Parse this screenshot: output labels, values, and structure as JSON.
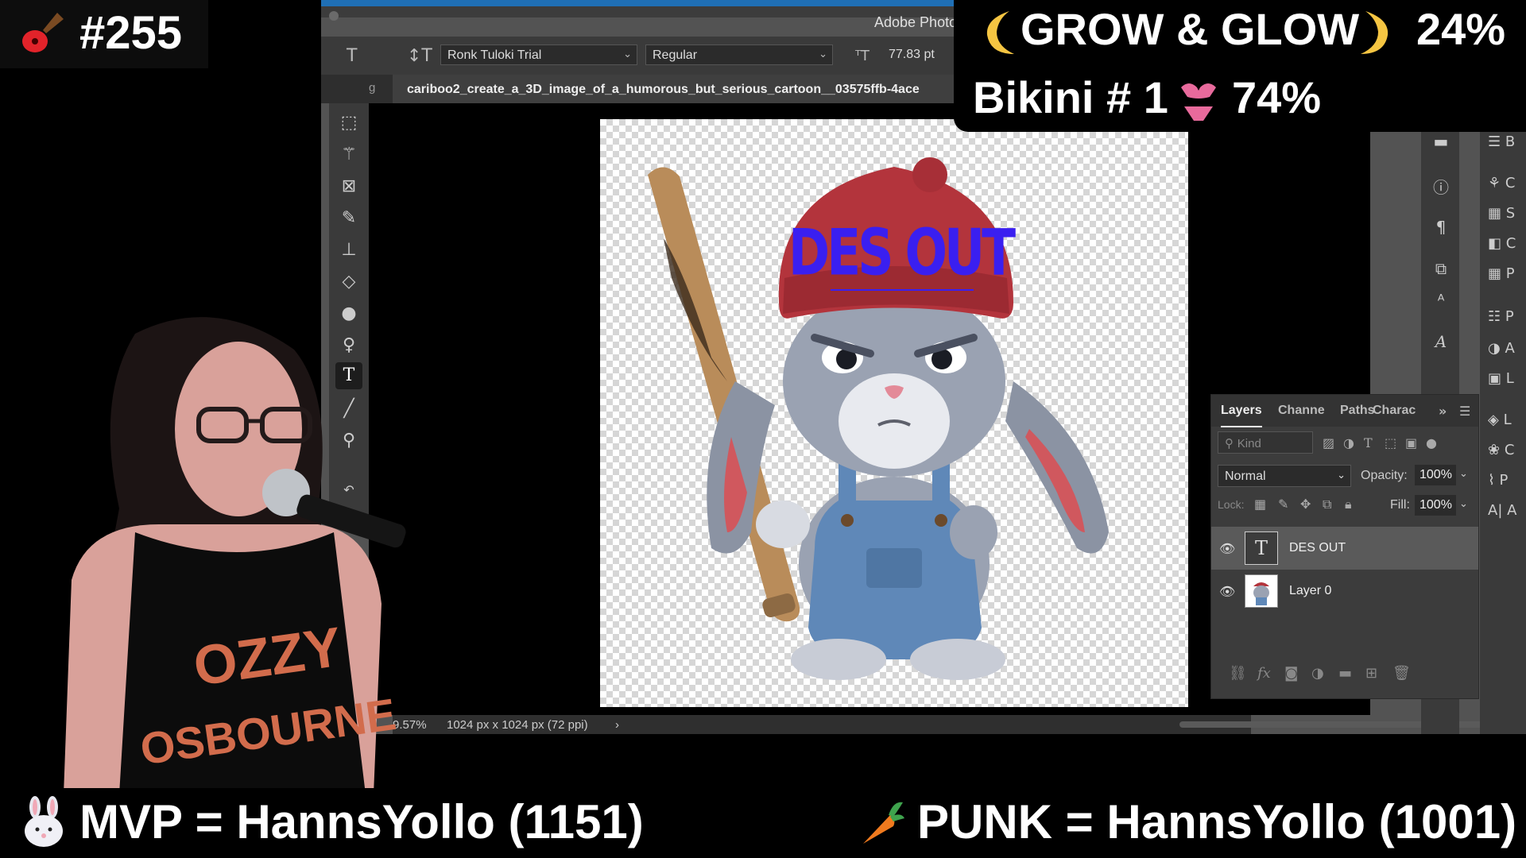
{
  "photoshop": {
    "app_title": "Adobe Photo",
    "options": {
      "font_family": "Ronk Tuloki Trial",
      "font_style": "Regular",
      "font_size": "77.83 pt"
    },
    "tabs": {
      "edge_label": "g",
      "document": "cariboo2_create_a_3D_image_of_a_humorous_but_serious_cartoon__03575ffb-4ace"
    },
    "status": {
      "zoom": "9.57%",
      "doc_info": "1024 px x 1024 px (72 ppi)",
      "arrow": "›"
    },
    "canvas_text": "DES OUT",
    "layers_panel": {
      "tabs": [
        "Layers",
        "Channe",
        "Paths",
        "Charac"
      ],
      "kind_placeholder": "Kind",
      "blend_mode": "Normal",
      "opacity_label": "Opacity:",
      "opacity_value": "100%",
      "lock_label": "Lock:",
      "fill_label": "Fill:",
      "fill_value": "100%",
      "layers": [
        {
          "name": "DES OUT",
          "type": "text",
          "selected": true
        },
        {
          "name": "Layer 0",
          "type": "image",
          "selected": false
        }
      ]
    },
    "right_dock_labels": [
      "B",
      "C",
      "S",
      "C",
      "P",
      "P",
      "A",
      "L",
      "L",
      "C",
      "P",
      "A"
    ]
  },
  "overlays": {
    "counter": "#255",
    "goal_line1_title": "GROW & GLOW",
    "goal_line1_pct": "24%",
    "goal_line2_title": "Bikini # 1",
    "goal_line2_pct": "74%",
    "mvp": "MVP = HannsYollo (1151)",
    "punk": "PUNK =  HannsYollo (1001)"
  },
  "colors": {
    "ps_bg": "#535353",
    "ps_panel": "#3c3c3c",
    "accent_blue": "#1f6fb5",
    "canvas_text": "#3a1ff0",
    "hat_red": "#b3343c"
  },
  "icons": [
    "guitar-icon",
    "moon-left-icon",
    "moon-right-icon",
    "bikini-icon",
    "rabbit-icon",
    "carrot-icon"
  ]
}
